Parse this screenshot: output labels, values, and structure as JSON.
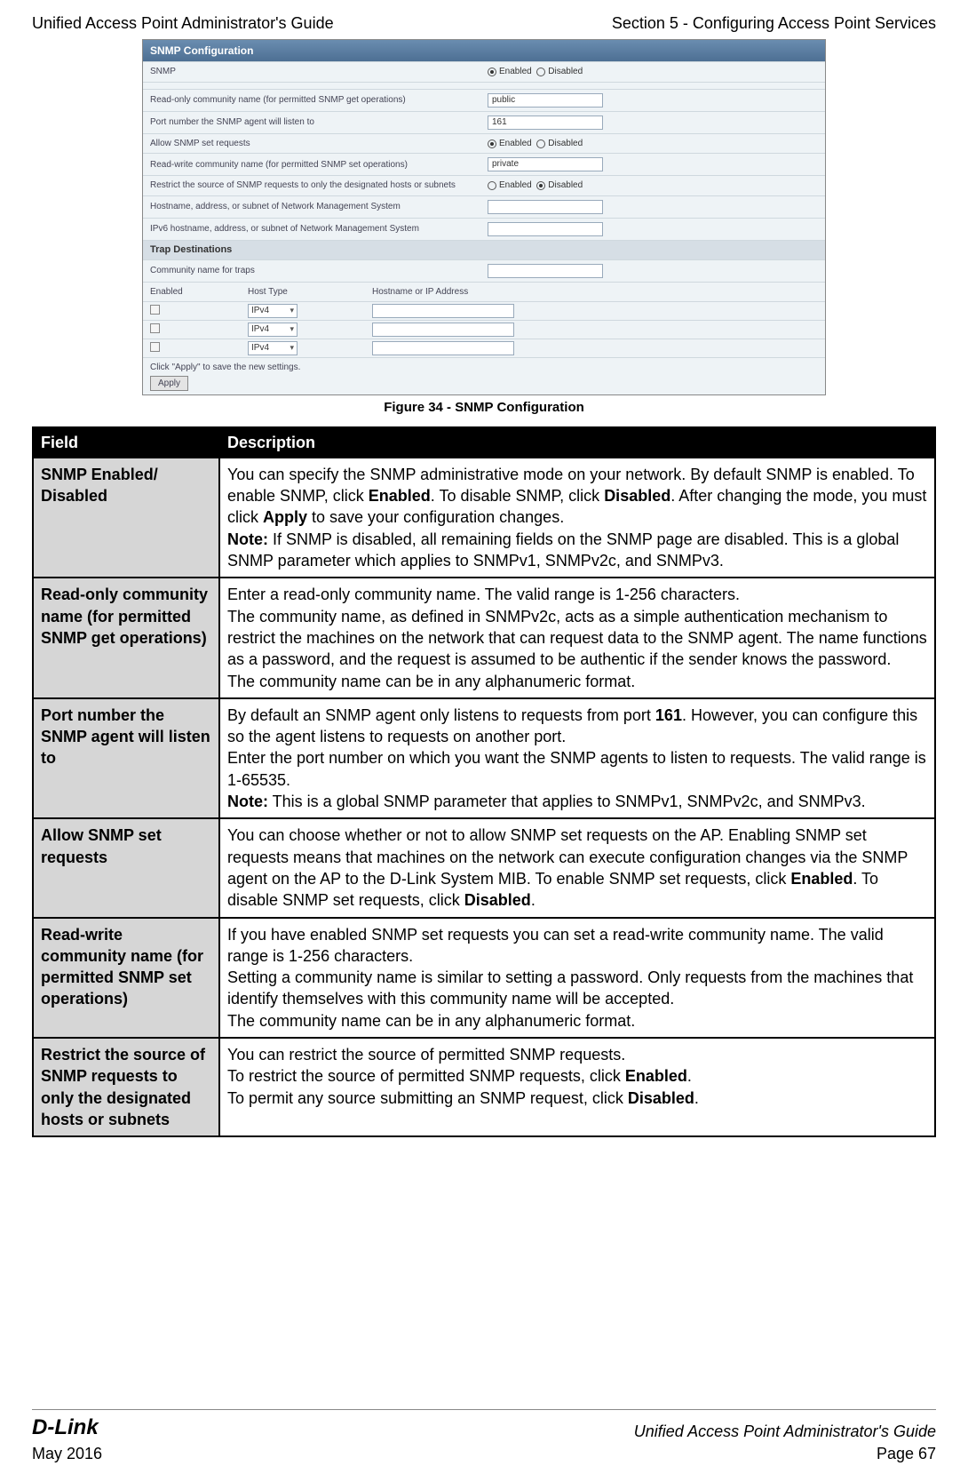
{
  "header": {
    "left": "Unified Access Point Administrator's Guide",
    "right": "Section 5 - Configuring Access Point Services"
  },
  "screenshot": {
    "title": "SNMP Configuration",
    "snmp_label": "SNMP",
    "enabled": "Enabled",
    "disabled": "Disabled",
    "rows": {
      "ro_comm": "Read-only community name (for permitted SNMP get operations)",
      "ro_val": "public",
      "port": "Port number the SNMP agent will listen to",
      "port_val": "161",
      "allow_set": "Allow SNMP set requests",
      "rw_comm": "Read-write community name (for permitted SNMP set operations)",
      "rw_val": "private",
      "restrict": "Restrict the source of SNMP requests to only the designated hosts or subnets",
      "host4": "Hostname, address, or subnet of Network Management System",
      "host6": "IPv6 hostname, address, or subnet of Network Management System"
    },
    "trap_section": "Trap Destinations",
    "trap_comm": "Community name for traps",
    "th_enabled": "Enabled",
    "th_hosttype": "Host Type",
    "th_hostaddr": "Hostname or IP Address",
    "ipv4": "IPv4",
    "foot_text": "Click \"Apply\" to save the new settings.",
    "apply": "Apply"
  },
  "caption": "Figure 34 - SNMP Configuration",
  "table": {
    "h_field": "Field",
    "h_desc": "Description",
    "rows": [
      {
        "field": "SNMP Enabled/\nDisabled",
        "desc_parts": {
          "p1a": "You can specify the SNMP administrative mode on your network. By default SNMP is enabled. To enable SNMP, click ",
          "b1": "Enabled",
          "p1b": ". To disable SNMP, click ",
          "b2": "Disabled",
          "p1c": ". After changing the mode, you must click ",
          "b3": "Apply",
          "p1d": " to save your configuration changes.",
          "note_lbl": "Note:",
          "note": " If SNMP is disabled, all remaining fields on the SNMP page are disabled. This is a global SNMP parameter which applies to SNMPv1, SNMPv2c, and SNMPv3."
        }
      },
      {
        "field": "Read-only community name (for permitted SNMP get operations)",
        "desc_parts": {
          "l1": "Enter a read-only community name. The valid range is 1-256 characters.",
          "l2": "The community name, as defined in SNMPv2c, acts as a simple authentication mechanism to restrict the machines on the network that can request data to the SNMP agent. The name functions as a password, and the request is assumed to be authentic if the sender knows the password.",
          "l3": "The community name can be in any alphanumeric format."
        }
      },
      {
        "field": "Port number the SNMP agent will listen to",
        "desc_parts": {
          "p1a": "By default an SNMP agent only listens to requests from port ",
          "b1": "161",
          "p1b": ". However, you can configure this so the agent listens to requests on another port.",
          "l2": "Enter the port number on which you want the SNMP agents to listen to requests. The valid range is 1-65535.",
          "note_lbl": "Note:",
          "note": " This is a global SNMP parameter that applies to SNMPv1, SNMPv2c, and SNMPv3."
        }
      },
      {
        "field": "Allow SNMP set requests",
        "desc_parts": {
          "p1a": "You can choose whether or not to allow SNMP set requests on the AP. Enabling SNMP set requests means that machines on the network can execute configuration changes via the SNMP agent on the AP to the D-Link System MIB. To enable SNMP set requests, click ",
          "b1": "Enabled",
          "p1b": ". To disable SNMP set requests, click ",
          "b2": "Disabled",
          "p1c": "."
        }
      },
      {
        "field": "Read-write community name (for permitted SNMP set operations)",
        "desc_parts": {
          "l1": "If you have enabled SNMP set requests you can set a read-write community name. The valid range is 1-256 characters.",
          "l2": "Setting a community name is similar to setting a password. Only requests from the machines that identify themselves with this community name will be accepted.",
          "l3": "The community name can be in any alphanumeric format."
        }
      },
      {
        "field": "Restrict the source of SNMP requests to only the designated hosts or subnets",
        "desc_parts": {
          "l1": "You can restrict the source of permitted SNMP requests.",
          "p2a": "To restrict the source of permitted SNMP requests, click ",
          "b2": "Enabled",
          "p2b": ".",
          "p3a": "To permit any source submitting an SNMP request, click ",
          "b3": "Disabled",
          "p3b": "."
        }
      }
    ]
  },
  "footer": {
    "logo": "D-Link",
    "date": "May 2016",
    "right1": "Unified Access Point Administrator's Guide",
    "right2": "Page 67"
  }
}
